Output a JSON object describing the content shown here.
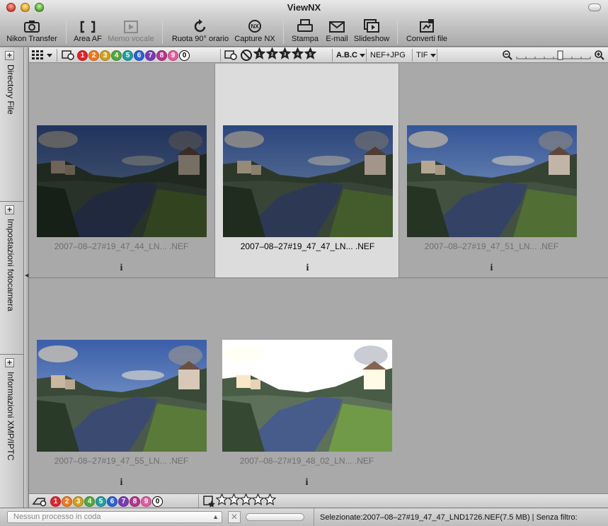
{
  "window": {
    "title": "ViewNX"
  },
  "toolbar": {
    "items": [
      {
        "label": "Nikon Transfer",
        "icon": "camera-transfer-icon",
        "enabled": true
      },
      {
        "label": "Area AF",
        "icon": "af-area-icon",
        "enabled": true
      },
      {
        "label": "Memo vocale",
        "icon": "voice-memo-icon",
        "enabled": false
      },
      {
        "label": "Ruota 90° orario",
        "icon": "rotate-cw-icon",
        "enabled": true
      },
      {
        "label": "Capture NX",
        "icon": "capture-nx-icon",
        "enabled": true
      },
      {
        "label": "Stampa",
        "icon": "printer-icon",
        "enabled": true
      },
      {
        "label": "E-mail",
        "icon": "mail-icon",
        "enabled": true
      },
      {
        "label": "Slideshow",
        "icon": "slideshow-icon",
        "enabled": true
      },
      {
        "label": "Converti file",
        "icon": "convert-file-icon",
        "enabled": true
      }
    ]
  },
  "filterbar": {
    "labels": [
      "1",
      "2",
      "3",
      "4",
      "5",
      "6",
      "7",
      "8",
      "9",
      "0"
    ],
    "label_colors": [
      "#e0242a",
      "#f07a20",
      "#d4a21a",
      "#52a83a",
      "#1ea0a0",
      "#2a62d8",
      "#7a3ab8",
      "#b8348a",
      "#e45ca0",
      "#ffffff"
    ],
    "star_filter": [
      "1",
      "2",
      "3",
      "4",
      "5"
    ],
    "sort": "A.B.C",
    "file_types": [
      "NEF+JPG",
      "TIF"
    ]
  },
  "sidebar": {
    "tabs": [
      {
        "label": "Directory File"
      },
      {
        "label": "Impostazioni fotocamera"
      },
      {
        "label": "Informazioni XMP/IPTC"
      }
    ]
  },
  "thumbnails": [
    {
      "filename": "2007–08–27#19_47_44_LN... .NEF",
      "info": "i",
      "selected": false,
      "brightness": 0.55
    },
    {
      "filename": "2007–08–27#19_47_47_LN... .NEF",
      "info": "i",
      "selected": true,
      "brightness": 0.75
    },
    {
      "filename": "2007–08–27#19_47_51_LN... .NEF",
      "info": "i",
      "selected": false,
      "brightness": 0.9
    },
    {
      "filename": "2007–08–27#19_47_55_LN... .NEF",
      "info": "i",
      "selected": false,
      "brightness": 1.0
    },
    {
      "filename": "2007–08–27#19_48_02_LN... .NEF",
      "info": "i",
      "selected": false,
      "brightness": 1.25
    }
  ],
  "labelbar": {
    "labels": [
      "1",
      "2",
      "3",
      "4",
      "5",
      "6",
      "7",
      "8",
      "9",
      "0"
    ],
    "stars": 5
  },
  "status": {
    "queue": "Nessun processo in coda",
    "cancel": "✕",
    "selection": "Selezionate:2007–08–27#19_47_47_LND1726.NEF(7.5 MB) | Senza filtro:"
  }
}
